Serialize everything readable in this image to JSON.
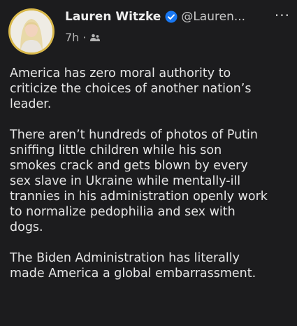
{
  "post": {
    "author_name": "Lauren Witzke",
    "handle": "@Lauren...",
    "more_icon": "more-dots-icon",
    "time": "7h",
    "separator": "·",
    "audience_icon": "globe-friends-icon",
    "verified_icon": "verified-badge-icon",
    "paragraphs": [
      "America has zero moral authority to\ncriticize the choices of another nation’s\nleader.",
      "There aren’t hundreds of photos of Putin\nsniffing little children while his son\nsmokes crack and gets blown by every\nsex slave in Ukraine while mentally-ill\ntrannies in his administration openly work\nto normalize pedophilia and sex with\ndogs.",
      "The Biden Administration has literally\nmade America a global embarrassment."
    ]
  },
  "colors": {
    "background": "#1c1c1e",
    "verified_blue": "#1877f2",
    "avatar_ring": "#d9b84a"
  }
}
